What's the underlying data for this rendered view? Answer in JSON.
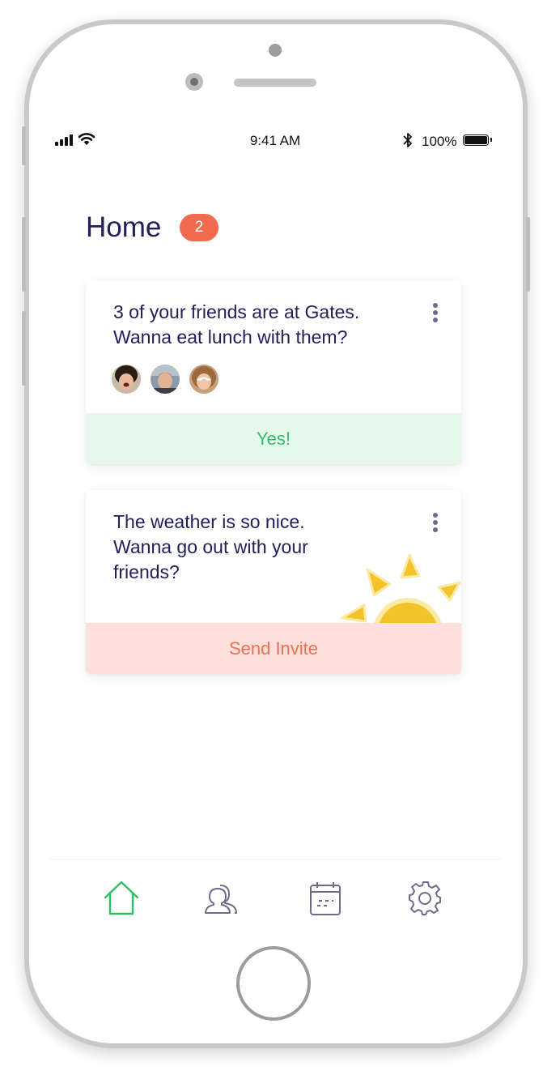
{
  "status_bar": {
    "time": "9:41 AM",
    "battery": "100%"
  },
  "header": {
    "title": "Home",
    "badge_count": "2"
  },
  "cards": [
    {
      "text": "3 of your friends are at Gates.\nWanna eat lunch with them?",
      "action_label": "Yes!",
      "avatars": [
        "friend-avatar-1",
        "friend-avatar-2",
        "friend-avatar-3"
      ]
    },
    {
      "text": "The weather is so nice.\nWanna go out with your\nfriends?",
      "action_label": "Send Invite",
      "decoration": "sun-icon"
    }
  ],
  "tabs": [
    {
      "icon": "home-icon",
      "active": true
    },
    {
      "icon": "friends-icon",
      "active": false
    },
    {
      "icon": "calendar-icon",
      "active": false
    },
    {
      "icon": "settings-icon",
      "active": false
    }
  ],
  "colors": {
    "title": "#22205a",
    "badge": "#f26b4f",
    "accent_green": "#2fbf64",
    "accent_red": "#ef6f55",
    "sun": "#f3c32a",
    "inactive_icon": "#6e6c8e"
  }
}
